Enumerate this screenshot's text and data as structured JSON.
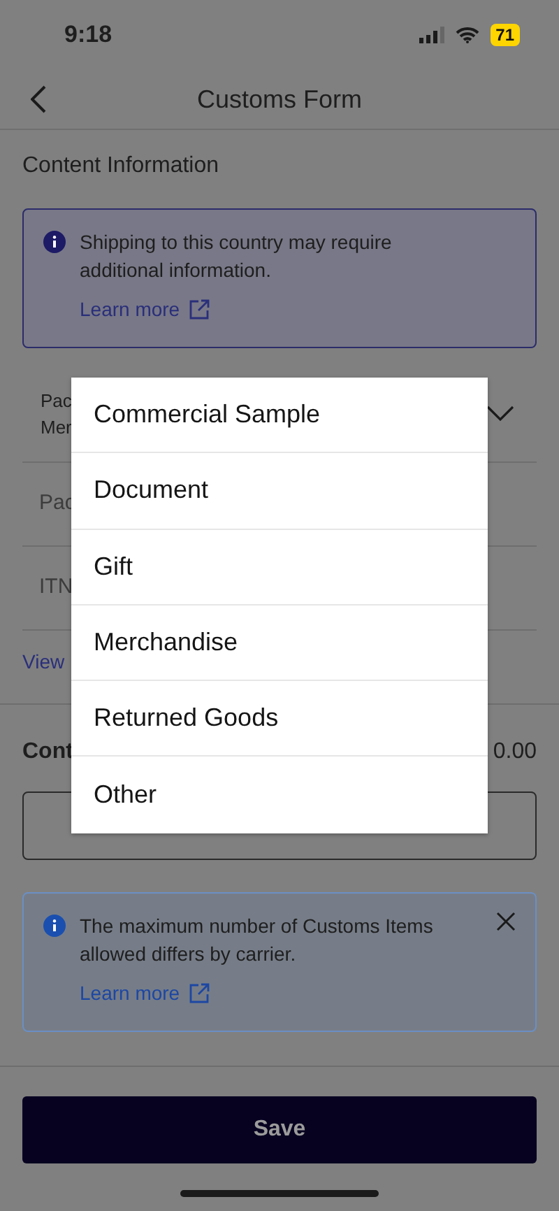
{
  "status_bar": {
    "time": "9:18",
    "battery": "71"
  },
  "header": {
    "title": "Customs Form"
  },
  "section": {
    "title": "Content Information"
  },
  "notice": {
    "text": "Shipping to this country may require additional information.",
    "link": "Learn more"
  },
  "fields": [
    {
      "kind": "select",
      "label": "Pac",
      "value": "Mer"
    },
    {
      "kind": "input",
      "placeholder": "Pac"
    },
    {
      "kind": "input",
      "placeholder": "ITN"
    }
  ],
  "view_link": "View",
  "contents": {
    "label": "Cont",
    "total": "0.00"
  },
  "carrier_notice": {
    "text": "The maximum number of Customs Items allowed differs by carrier.",
    "link": "Learn more"
  },
  "save_button": "Save",
  "dropdown": {
    "options": [
      "Commercial Sample",
      "Document",
      "Gift",
      "Merchandise",
      "Returned Goods",
      "Other"
    ]
  }
}
